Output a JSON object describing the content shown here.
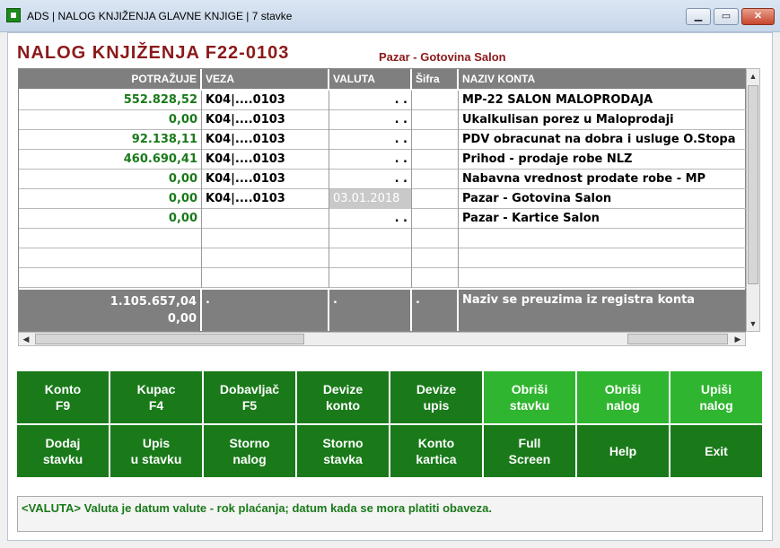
{
  "window": {
    "title": "ADS | NALOG KNJIŽENJA GLAVNE KNJIGE | 7 stavke",
    "min_glyph": "▁",
    "max_glyph": "▭",
    "close_glyph": "✕"
  },
  "document": {
    "title": "NALOG KNJIŽENJA F22-0103",
    "subtitle": "Pazar - Gotovina Salon"
  },
  "grid": {
    "columns": [
      "POTRAŽUJE",
      "VEZA",
      "VALUTA",
      "Šifra",
      "NAZIV KONTA"
    ],
    "rows": [
      {
        "potrazuje": "552.828,52",
        "veza": "K04|....0103",
        "valuta": ". .",
        "sifra": "",
        "naziv": "MP-22 SALON MALOPRODAJA"
      },
      {
        "potrazuje": "0,00",
        "veza": "K04|....0103",
        "valuta": ". .",
        "sifra": "",
        "naziv": "Ukalkulisan porez u Maloprodaji"
      },
      {
        "potrazuje": "92.138,11",
        "veza": "K04|....0103",
        "valuta": ". .",
        "sifra": "",
        "naziv": "PDV obracunat na dobra i usluge O.Stopa"
      },
      {
        "potrazuje": "460.690,41",
        "veza": "K04|....0103",
        "valuta": ". .",
        "sifra": "",
        "naziv": "Prihod - prodaje robe NLZ"
      },
      {
        "potrazuje": "0,00",
        "veza": "K04|....0103",
        "valuta": ". .",
        "sifra": "",
        "naziv": "Nabavna vrednost prodate robe - MP"
      },
      {
        "potrazuje": "0,00",
        "veza": "K04|....0103",
        "valuta": "03.01.2018",
        "sifra": "",
        "naziv": "Pazar - Gotovina Salon"
      },
      {
        "potrazuje": "0,00",
        "veza": "",
        "valuta": ". .",
        "sifra": "",
        "naziv": "Pazar - Kartice Salon"
      },
      {
        "potrazuje": "",
        "veza": "",
        "valuta": "",
        "sifra": "",
        "naziv": ""
      },
      {
        "potrazuje": "",
        "veza": "",
        "valuta": "",
        "sifra": "",
        "naziv": ""
      },
      {
        "potrazuje": "",
        "veza": "",
        "valuta": "",
        "sifra": "",
        "naziv": ""
      }
    ],
    "totals": {
      "potrazuje_1": "1.105.657,04",
      "potrazuje_2": "0,00",
      "veza": ".",
      "valuta": ".",
      "sifra": ".",
      "naziv": "Naziv se preuzima iz registra konta"
    }
  },
  "scroll": {
    "up": "▲",
    "down": "▼",
    "left": "◀",
    "right": "▶"
  },
  "buttons": [
    {
      "line1": "Konto",
      "line2": "F9",
      "light": false
    },
    {
      "line1": "Kupac",
      "line2": "F4",
      "light": false
    },
    {
      "line1": "Dobavljač",
      "line2": "F5",
      "light": false
    },
    {
      "line1": "Devize",
      "line2": "konto",
      "light": false
    },
    {
      "line1": "Devize",
      "line2": "upis",
      "light": false
    },
    {
      "line1": "Obriši",
      "line2": "stavku",
      "light": true
    },
    {
      "line1": "Obriši",
      "line2": "nalog",
      "light": true
    },
    {
      "line1": "Upiši",
      "line2": "nalog",
      "light": true
    },
    {
      "line1": "Dodaj",
      "line2": "stavku",
      "light": false
    },
    {
      "line1": "Upis",
      "line2": "u stavku",
      "light": false
    },
    {
      "line1": "Storno",
      "line2": "nalog",
      "light": false
    },
    {
      "line1": "Storno",
      "line2": "stavka",
      "light": false
    },
    {
      "line1": "Konto",
      "line2": "kartica",
      "light": false
    },
    {
      "line1": "Full",
      "line2": "Screen",
      "light": false
    },
    {
      "line1": "Help",
      "line2": "",
      "light": false
    },
    {
      "line1": "Exit",
      "line2": "",
      "light": false
    }
  ],
  "status": {
    "text": "<VALUTA> Valuta je datum valute - rok plaćanja; datum kada se mora platiti obaveza."
  }
}
